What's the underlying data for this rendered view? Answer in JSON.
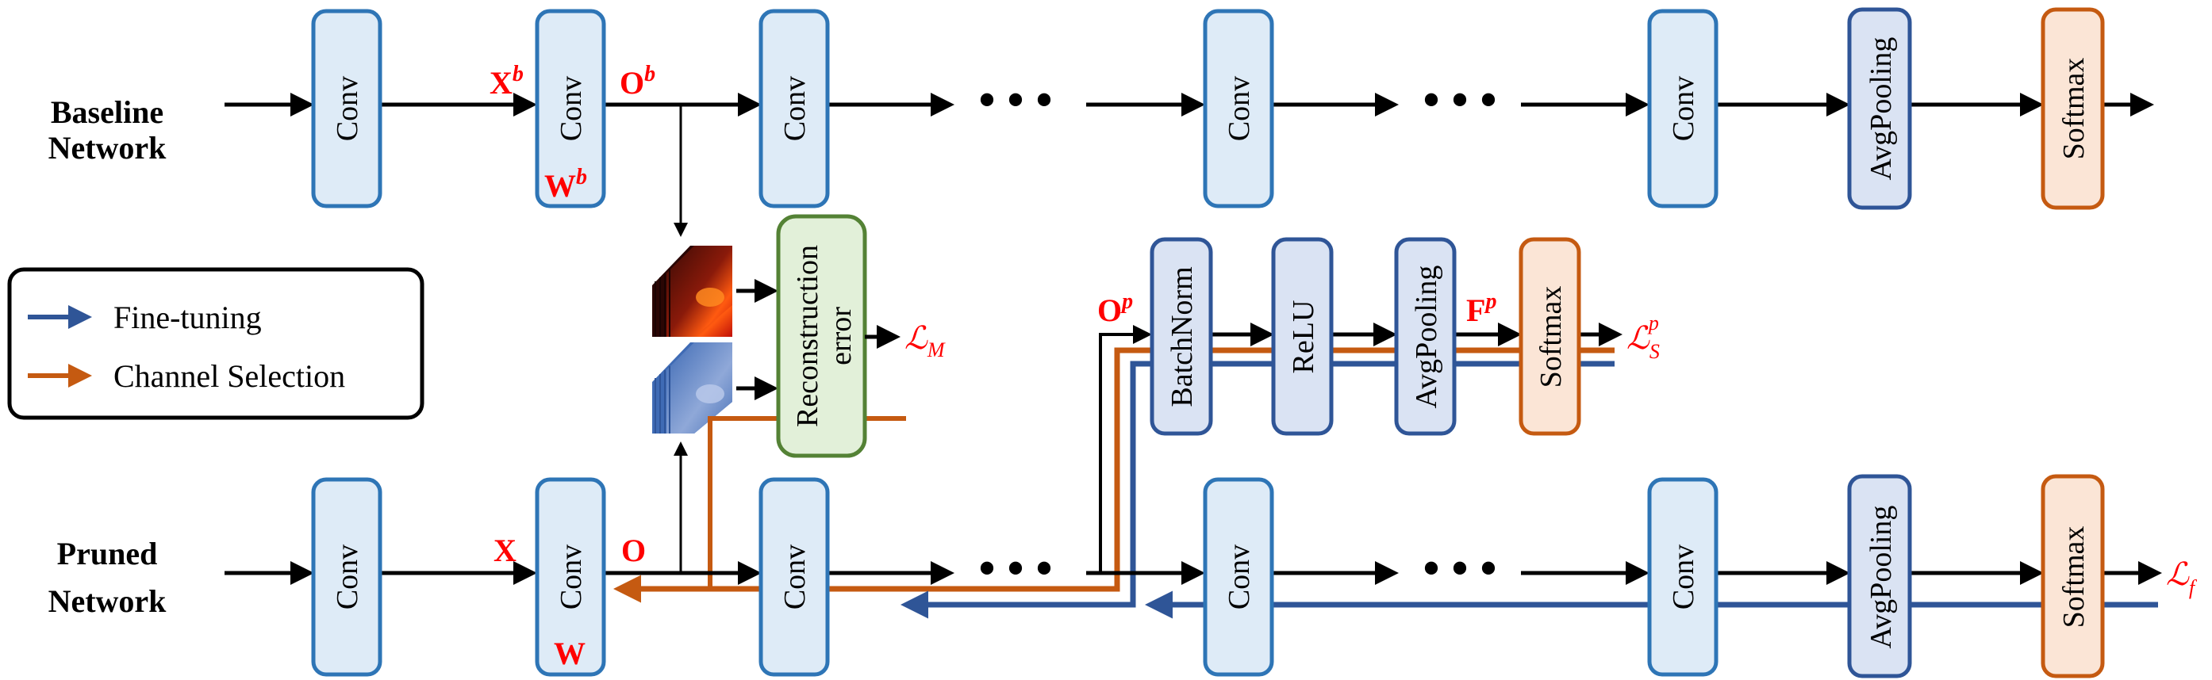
{
  "rows": {
    "baseline": {
      "label_line1": "Baseline",
      "label_line2": "Network"
    },
    "pruned": {
      "label_line1": "Pruned",
      "label_line2": "Network"
    }
  },
  "blocks": {
    "conv": "Conv",
    "avgpool": "AvgPooling",
    "softmax": "Softmax",
    "batchnorm": "BatchNorm",
    "relu": "ReLU",
    "recon_line1": "Reconstruction",
    "recon_line2": "error"
  },
  "ellipsis": "• • •",
  "symbols": {
    "Xb": "X",
    "Xb_sup": "b",
    "Ob": "O",
    "Ob_sup": "b",
    "Wb": "W",
    "Wb_sup": "b",
    "X": "X",
    "O": "O",
    "W": "W",
    "Op": "O",
    "Op_sup": "p",
    "Fp": "F",
    "Fp_sup": "p",
    "LM": "ℒ",
    "LM_sub": "M",
    "LSp": "ℒ",
    "LSp_sub": "S",
    "LSp_sup": "p",
    "Lf": "ℒ",
    "Lf_sub": "f"
  },
  "legend": {
    "items": [
      {
        "label": "Fine-tuning",
        "color": "#2f5597"
      },
      {
        "label": "Channel Selection",
        "color": "#c55a11"
      }
    ]
  },
  "colors": {
    "conv_fill": "#deebf7",
    "conv_stroke": "#2e75b6",
    "pool_fill": "#dae3f3",
    "pool_stroke": "#2f5597",
    "softmax_fill": "#fbe5d6",
    "softmax_stroke": "#c55a11",
    "recon_fill": "#e2f0d9",
    "recon_stroke": "#548235",
    "finetune": "#2f5597",
    "channel": "#c55a11",
    "label_red": "#ff0000"
  }
}
